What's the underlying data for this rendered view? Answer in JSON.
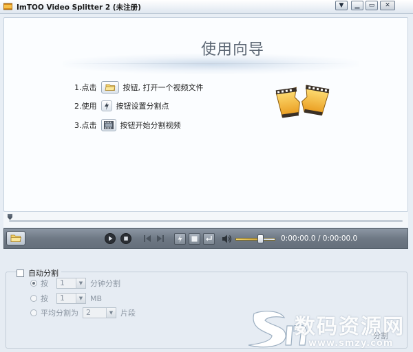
{
  "window": {
    "title": "ImTOO Video Splitter 2 (未注册)"
  },
  "titlebar": {
    "menu_icon": "chevron-down-icon",
    "minimize_icon": "minimize-icon",
    "maximize_icon": "maximize-icon",
    "close_icon": "close-icon"
  },
  "guide": {
    "title": "使用向导",
    "step1_prefix": "1.点击",
    "step1_suffix": "按钮, 打开一个视频文件",
    "step2_prefix": "2.使用",
    "step2_suffix": "按钮设置分割点",
    "step3_prefix": "3.点击",
    "step3_suffix": "按钮开始分割视频"
  },
  "player": {
    "time_display": "0:00:00.0 / 0:00:00.0",
    "volume_level": 0.62,
    "progress_level": 0.0
  },
  "split": {
    "auto_split_label": "自动分割",
    "by_minutes_prefix": "按",
    "by_minutes_value": "1",
    "by_minutes_suffix": "分钟分割",
    "by_size_prefix": "按",
    "by_size_value": "1",
    "by_size_suffix": "MB",
    "average_prefix": "平均分割为",
    "average_value": "2",
    "average_suffix": "片段",
    "split_button_label": "分割"
  },
  "watermark": {
    "brand": "数码资源网",
    "site": "www.smzy.com"
  }
}
